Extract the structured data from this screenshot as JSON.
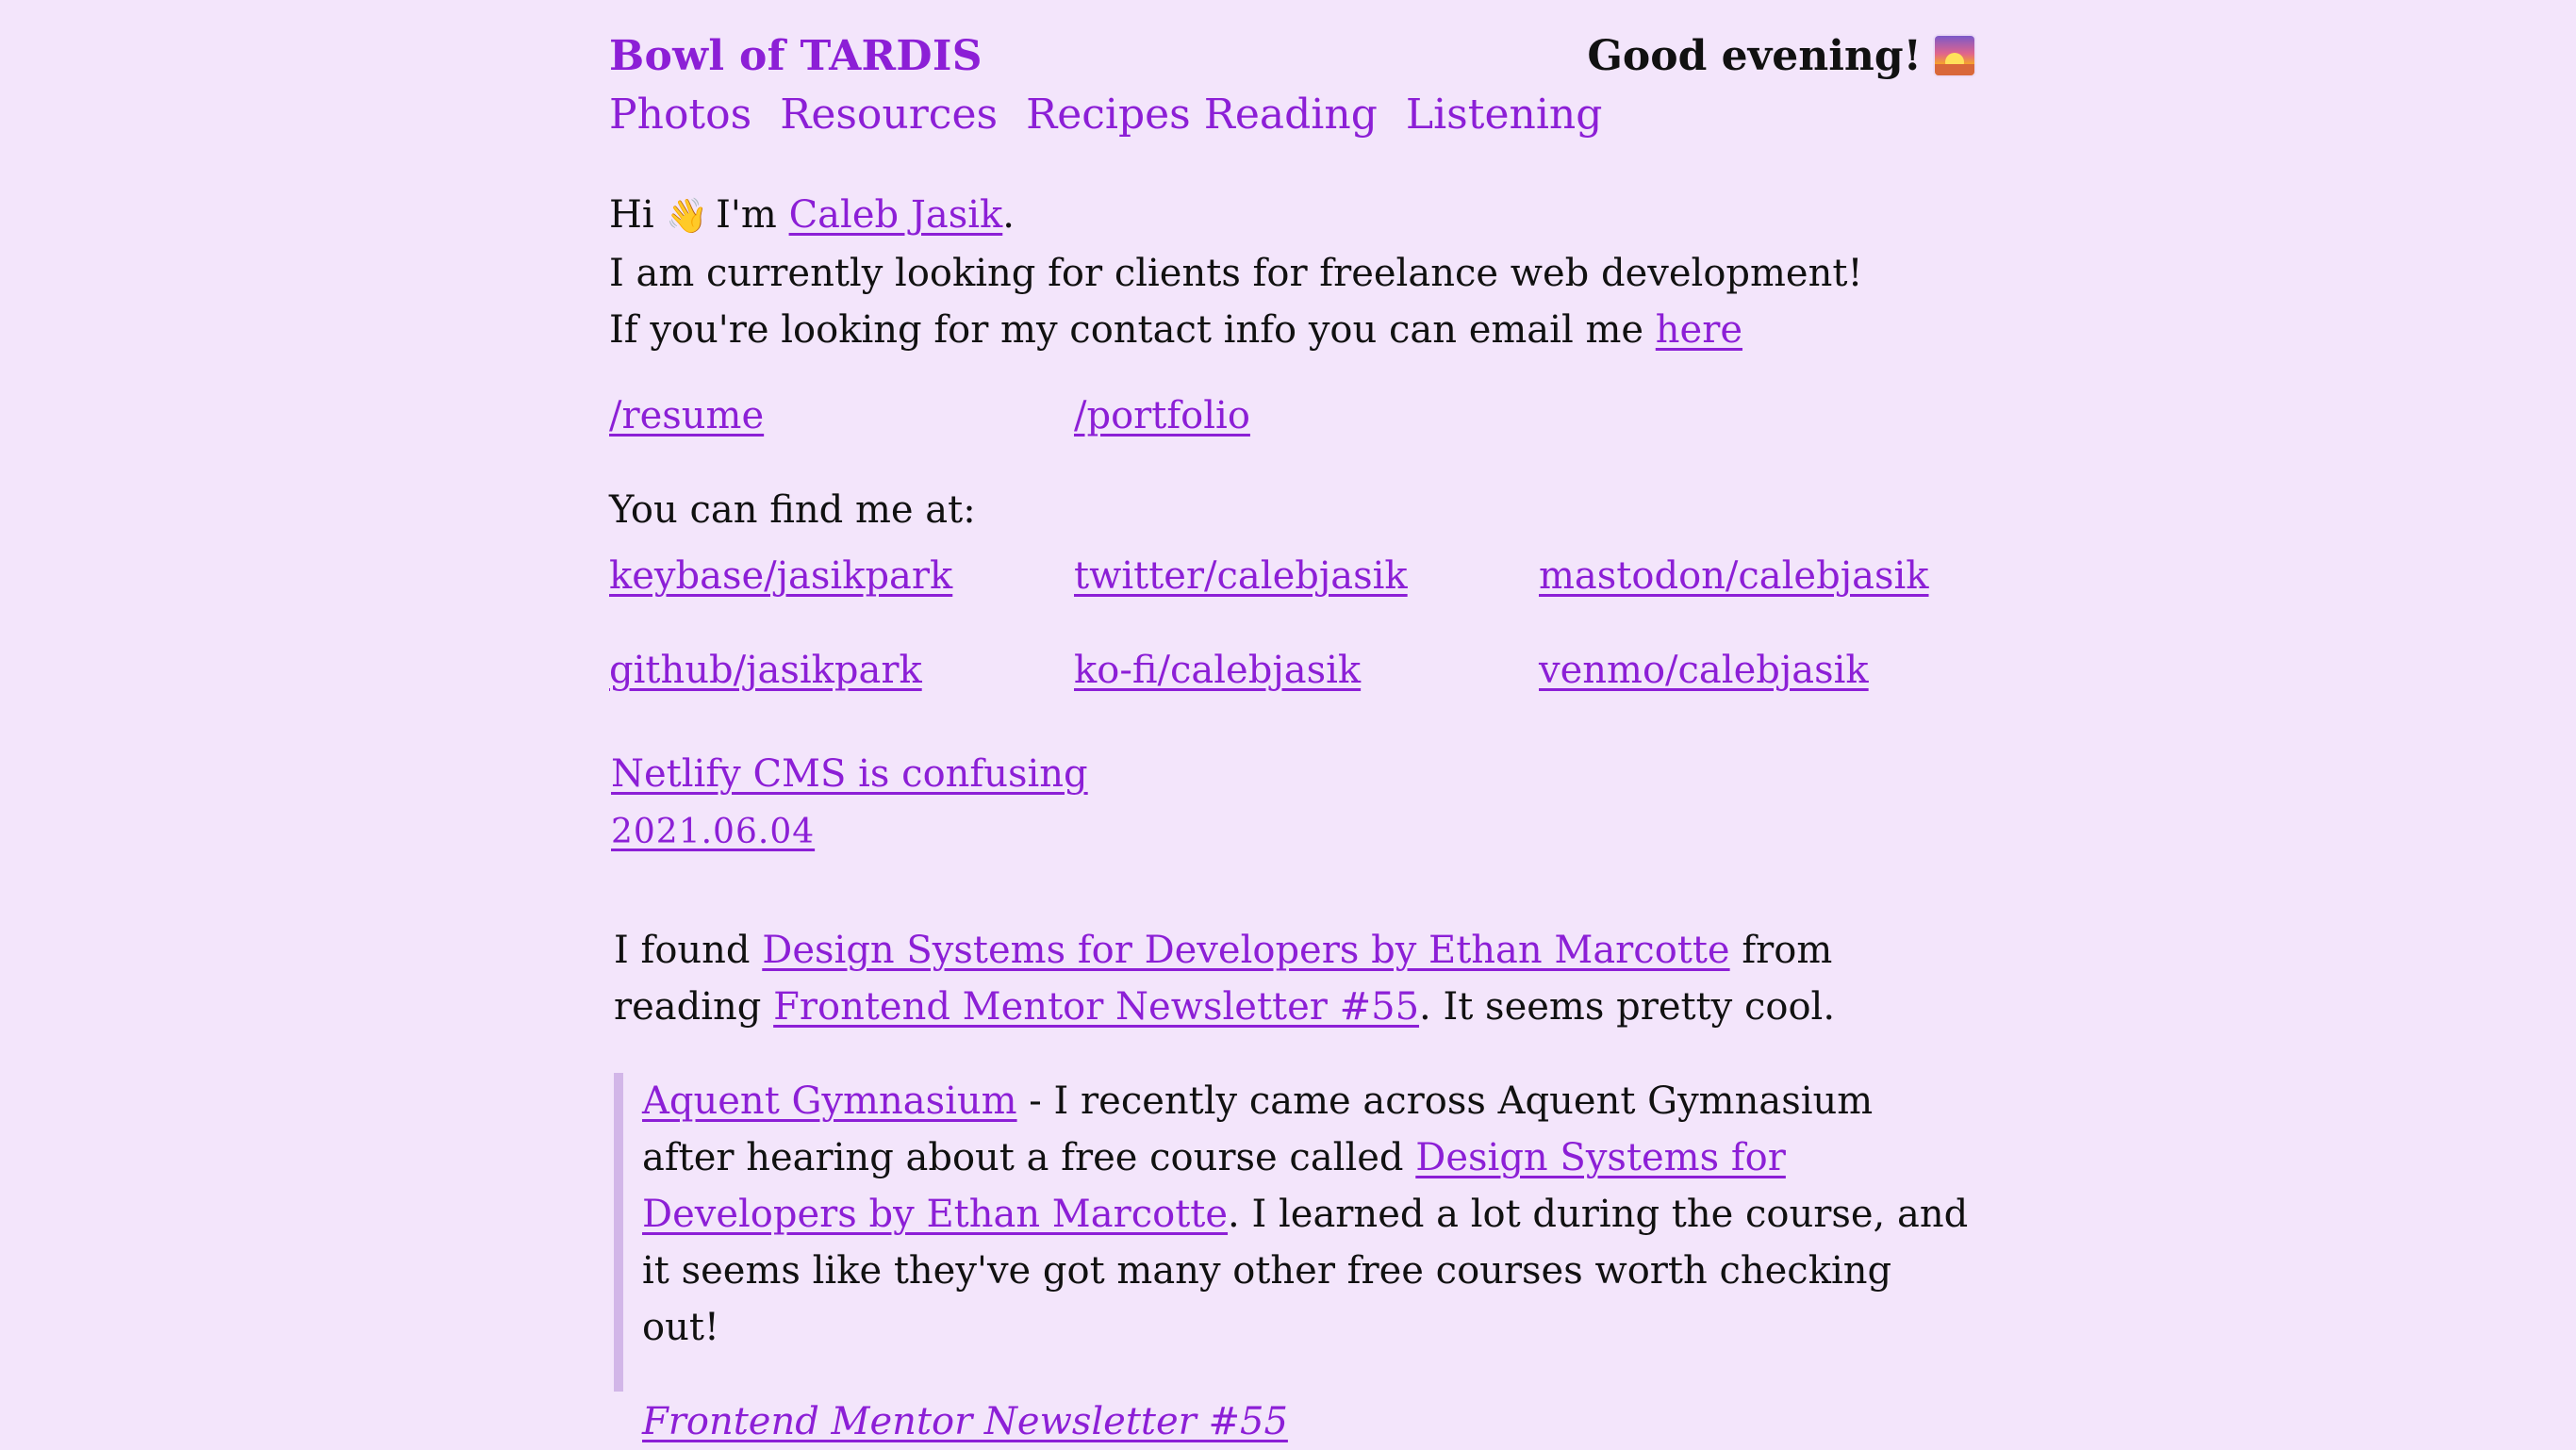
{
  "header": {
    "site_title": "Bowl of TARDIS",
    "greeting": "Good evening!",
    "greeting_icon": "sunset-icon"
  },
  "nav": {
    "items": [
      "Photos",
      "Resources",
      "Recipes",
      "Reading",
      "Listening"
    ]
  },
  "intro": {
    "hi": "Hi",
    "wave_icon": "👋",
    "im": "I'm",
    "name": "Caleb Jasik",
    "period": ".",
    "line2": "I am currently looking for clients for freelance web development!",
    "line3_prefix": "If you're looking for my contact info you can email me",
    "email_link": "here"
  },
  "pages": {
    "resume": "/resume",
    "portfolio": "/portfolio"
  },
  "find": {
    "label": "You can find me at:",
    "links": [
      "keybase/jasikpark",
      "twitter/calebjasik",
      "mastodon/calebjasik",
      "github/jasikpark",
      "ko-fi/calebjasik",
      "venmo/calebjasik"
    ]
  },
  "post": {
    "title": "Netlify CMS is confusing",
    "date": "2021.06.04",
    "body": {
      "p1": "I found",
      "link1": "Design Systems for Developers by Ethan Marcotte",
      "p2": "from reading",
      "link2": "Frontend Mentor Newsletter #55",
      "p3": ". It seems pretty cool."
    },
    "quote": {
      "link1": "Aquent Gymnasium",
      "t1": " - I recently came across Aquent Gymnasium after hearing about a free course called ",
      "link2": "Design Systems for Developers by Ethan Marcotte",
      "t2": ". I learned a lot during the course, and it seems like they've got many other free courses worth checking out!",
      "cite": "Frontend Mentor Newsletter #55"
    }
  },
  "colors": {
    "background": "#f3e5fb",
    "link": "#8c1fd6",
    "text": "#111111",
    "quote_border": "#d2b6e8"
  }
}
